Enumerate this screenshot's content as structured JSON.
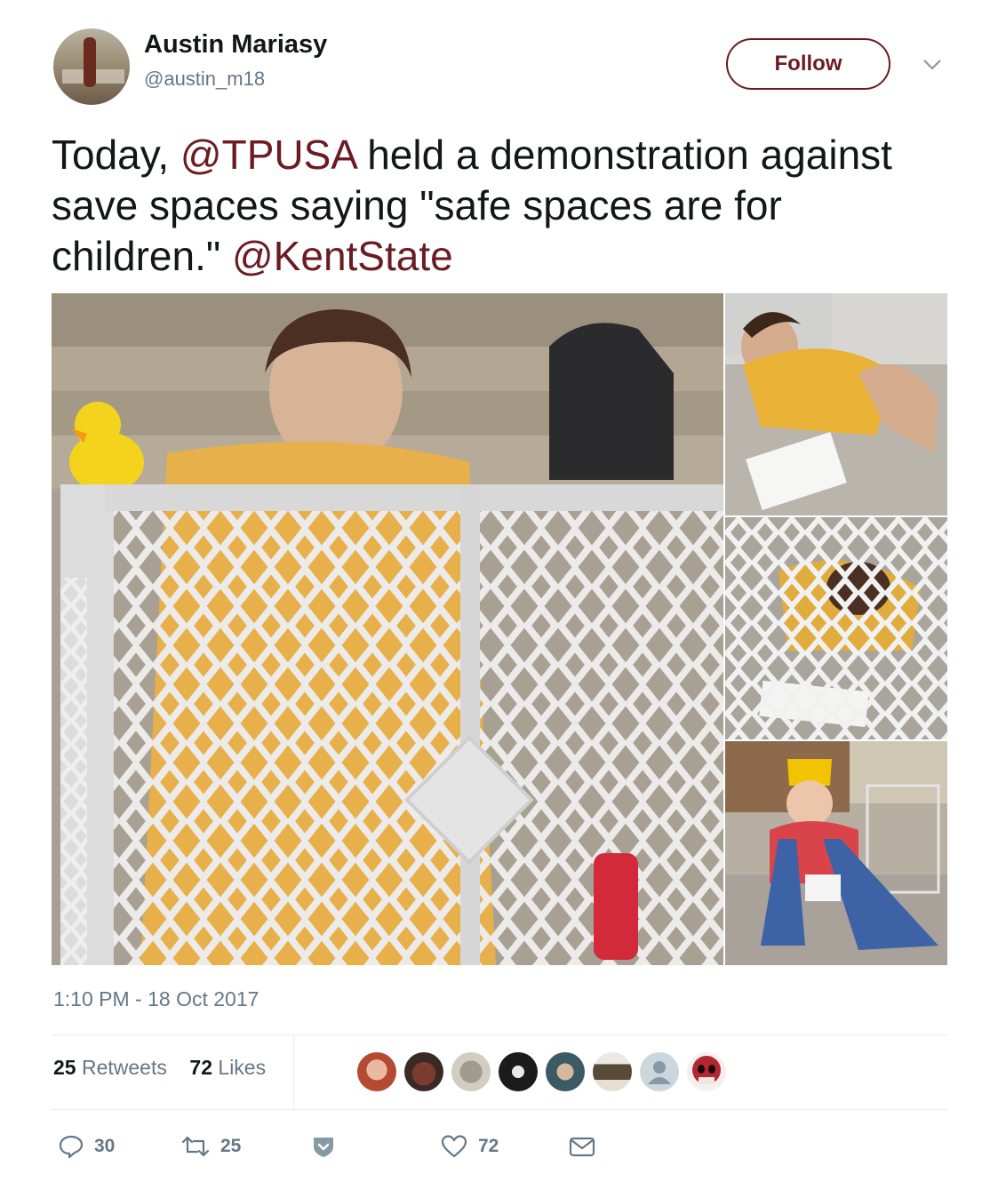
{
  "author": {
    "name": "Austin Mariasy",
    "handle": "@austin_m18"
  },
  "follow_label": "Follow",
  "tweet": {
    "part1": "Today, ",
    "mention1": "@TPUSA",
    "part2": " held a demonstration against save spaces saying \"safe spaces are for children.\" ",
    "mention2": "@KentState"
  },
  "timestamp": "1:10 PM - 18 Oct 2017",
  "stats": {
    "retweets_count": "25",
    "retweets_label": "Retweets",
    "likes_count": "72",
    "likes_label": "Likes"
  },
  "actions": {
    "replies": "30",
    "retweets": "25",
    "likes": "72"
  },
  "colors": {
    "accent": "#6b1b22",
    "muted": "#657786",
    "text": "#14171a"
  },
  "icons": [
    "chevron-down-icon",
    "reply-icon",
    "retweet-icon",
    "heart-icon",
    "mail-icon",
    "shield-icon"
  ]
}
